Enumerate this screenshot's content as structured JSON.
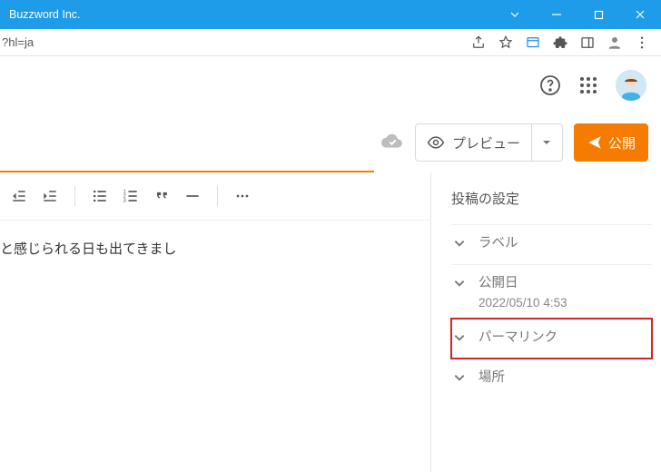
{
  "window": {
    "title": "Buzzword Inc."
  },
  "url": {
    "fragment": "?hl=ja"
  },
  "actions": {
    "preview_label": "プレビュー",
    "publish_label": "公開"
  },
  "editor": {
    "content_text": "と感じられる日も出てきまし"
  },
  "sidebar": {
    "title": "投稿の設定",
    "items": [
      {
        "label": "ラベル"
      },
      {
        "label": "公開日",
        "subtext": "2022/05/10 4:53"
      },
      {
        "label": "パーマリンク"
      },
      {
        "label": "場所"
      }
    ]
  }
}
